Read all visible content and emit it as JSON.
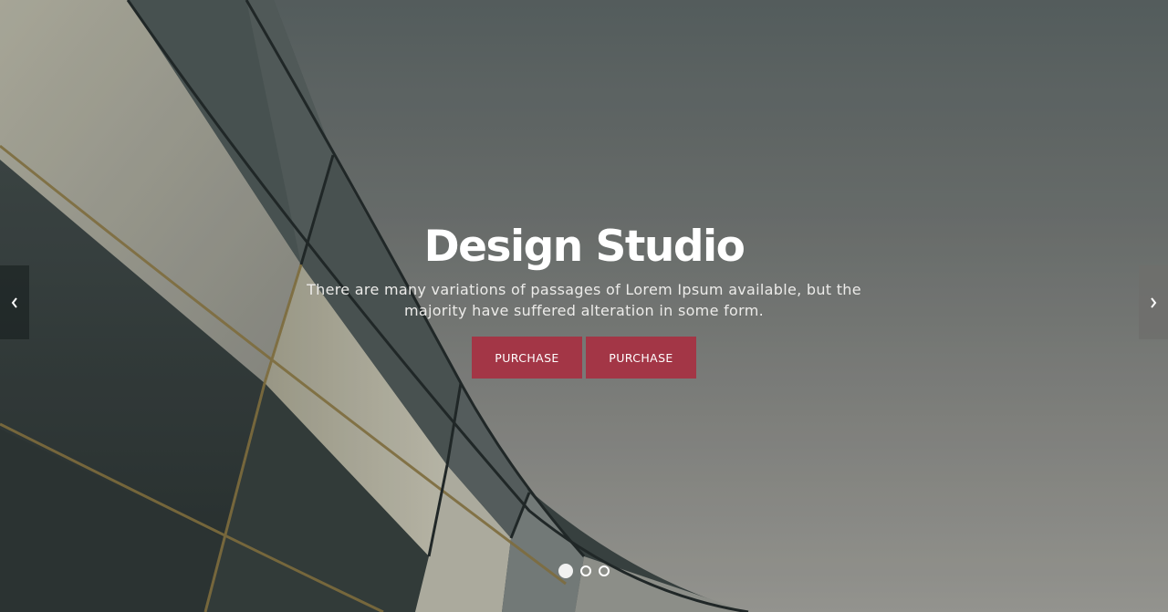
{
  "hero": {
    "title": "Design Studio",
    "subtitle": "There are many variations of passages of Lorem Ipsum available, but the majority have suffered alteration in some form.",
    "buttons": [
      {
        "label": "PURCHASE"
      },
      {
        "label": "PURCHASE"
      }
    ]
  },
  "slider": {
    "prev_icon": "chevron-left-icon",
    "next_icon": "chevron-right-icon",
    "slide_count": 3,
    "active_index": 0
  },
  "colors": {
    "button_bg": "#a33646",
    "title": "#ffffff"
  }
}
